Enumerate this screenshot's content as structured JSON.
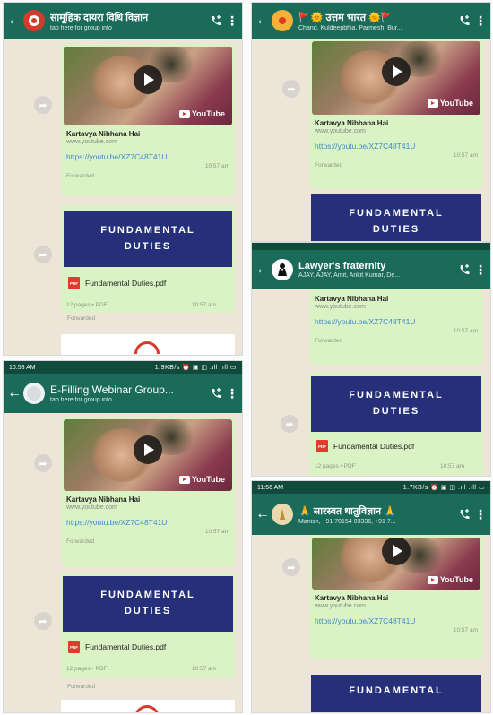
{
  "video": {
    "title": "Kartavya Nibhana Hai",
    "domain": "www.youtube.com",
    "link": "https://youtu.be/XZ7C48T41U",
    "time": "10:57 am",
    "youtube_label": "YouTube"
  },
  "banner": {
    "line1": "FUNDAMENTAL",
    "line2": "DUTIES"
  },
  "pdf": {
    "name": "Fundamental Duties.pdf",
    "meta": "12 pages • PDF",
    "time": "10:57 am"
  },
  "forwarded": "Forwarded",
  "panels": {
    "p1": {
      "title": "सामूहिक दायरा विधि विज्ञान",
      "subtitle": "tap here for group info"
    },
    "p2": {
      "title": "🚩🌞 उत्तम भारत 🌞🚩",
      "subtitle": "Chand, Kuldeepbhia, Parmesh, Bur..."
    },
    "p3": {
      "title": "Lawyer's fraternity",
      "subtitle": "AJAY, AJAY, Amit, Ankit Kumar, De..."
    },
    "p4": {
      "title": "E-Filling Webinar Group...",
      "subtitle": "tap here for group info",
      "status_time": "10:58 AM",
      "status_right": "1.9KB/s ⏰ ▣ ◫ .ıll .ıll ▭"
    },
    "p5": {
      "title": "🙏 सारस्वत धातुविज्ञान 🙏",
      "subtitle": "Manish, +91 70154 03336, +91 7...",
      "status_time": "11:56 AM",
      "status_right": "1.7KB/s ⏰ ▣ ◫ .ıll .ıll ▭"
    }
  },
  "icons": {
    "back": "arrow-left",
    "call": "phone-plus",
    "menu": "more-vertical",
    "forward": "share-arrow",
    "play": "play-triangle",
    "pdf": "pdf-file"
  },
  "colors": {
    "header": "#1a6b5a",
    "statusbar": "#0f4a3b",
    "bubble": "#dbf3c4",
    "chat_bg": "#ede5d8",
    "banner": "#26307a",
    "link": "#3a8bd0"
  }
}
